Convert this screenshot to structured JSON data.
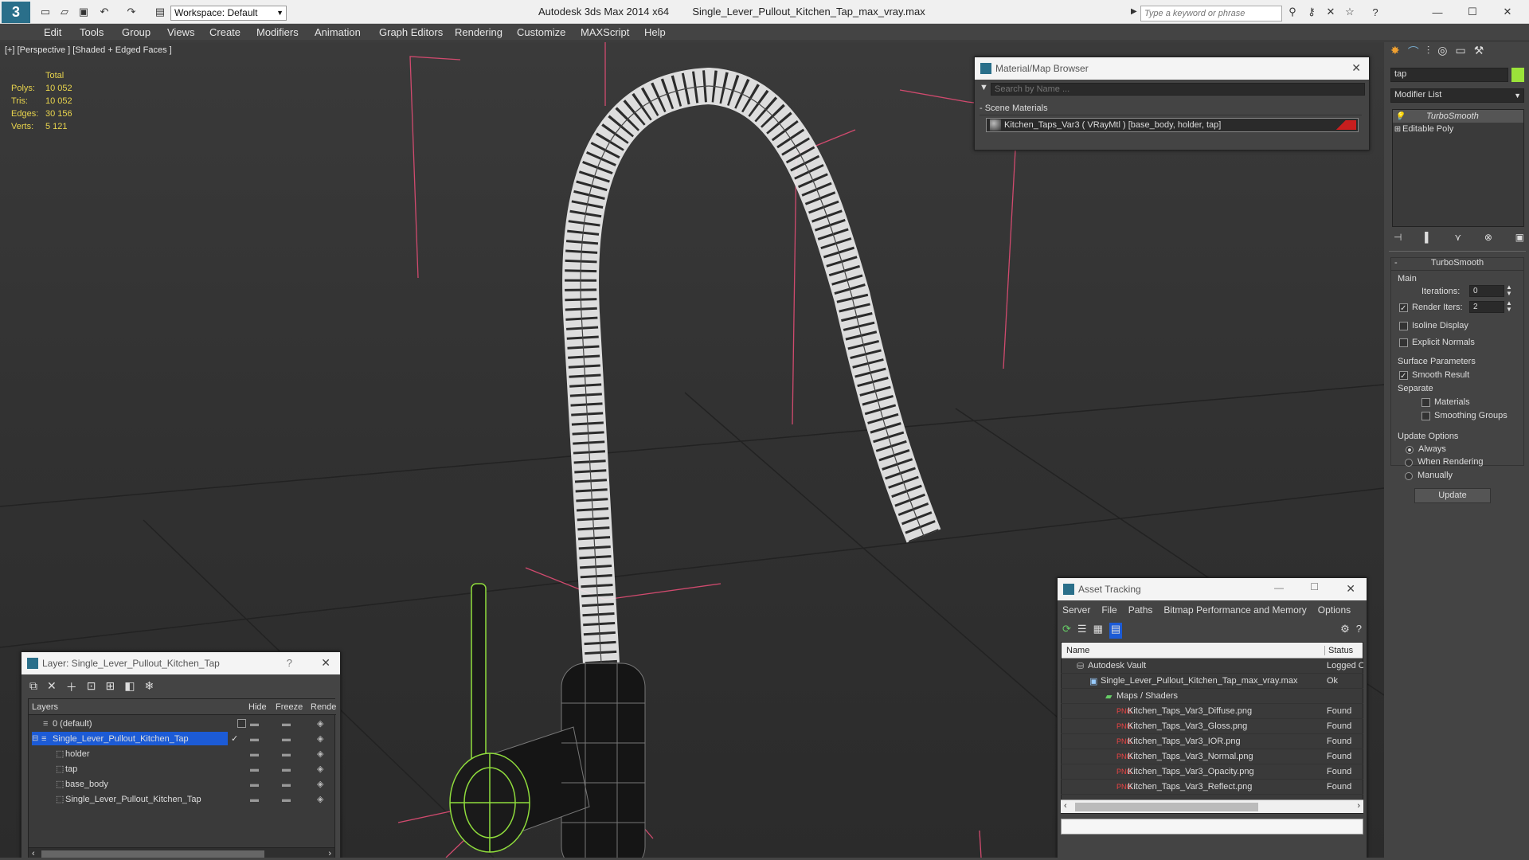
{
  "titlebar": {
    "app": "Autodesk 3ds Max  2014 x64",
    "file": "Single_Lever_Pullout_Kitchen_Tap_max_vray.max",
    "workspace": "Workspace: Default",
    "search_placeholder": "Type a keyword or phrase"
  },
  "menu": [
    "Edit",
    "Tools",
    "Group",
    "Views",
    "Create",
    "Modifiers",
    "Animation",
    "Graph Editors",
    "Rendering",
    "Customize",
    "MAXScript",
    "Help"
  ],
  "viewport": {
    "label": "[+] [Perspective ] [Shaded + Edged Faces ]",
    "stats_header": "Total",
    "stats": [
      {
        "label": "Polys:",
        "value": "10 052"
      },
      {
        "label": "Tris:",
        "value": "10 052"
      },
      {
        "label": "Edges:",
        "value": "30 156"
      },
      {
        "label": "Verts:",
        "value": "5 121"
      }
    ]
  },
  "material_browser": {
    "title": "Material/Map Browser",
    "search_placeholder": "Search by Name ...",
    "section": "- Scene Materials",
    "item": "Kitchen_Taps_Var3  ( VRayMtl ) [base_body, holder, tap]"
  },
  "layer_window": {
    "title": "Layer: Single_Lever_Pullout_Kitchen_Tap",
    "help": "?",
    "columns": [
      "Layers",
      "Hide",
      "Freeze",
      "Render"
    ],
    "rows": [
      {
        "name": "0 (default)",
        "indent": 0
      },
      {
        "name": "Single_Lever_Pullout_Kitchen_Tap",
        "indent": 0,
        "selected": true
      },
      {
        "name": "holder",
        "indent": 1
      },
      {
        "name": "tap",
        "indent": 1
      },
      {
        "name": "base_body",
        "indent": 1
      },
      {
        "name": "Single_Lever_Pullout_Kitchen_Tap",
        "indent": 1
      }
    ]
  },
  "asset_tracking": {
    "title": "Asset Tracking",
    "menu": [
      "Server",
      "File",
      "Paths",
      "Bitmap Performance and Memory",
      "Options"
    ],
    "columns": [
      "Name",
      "Status"
    ],
    "rows": [
      {
        "name": "Autodesk Vault",
        "status": "Logged O",
        "level": 1
      },
      {
        "name": "Single_Lever_Pullout_Kitchen_Tap_max_vray.max",
        "status": "Ok",
        "level": 2
      },
      {
        "name": "Maps / Shaders",
        "status": "",
        "level": 3
      },
      {
        "name": "Kitchen_Taps_Var3_Diffuse.png",
        "status": "Found",
        "level": 4
      },
      {
        "name": "Kitchen_Taps_Var3_Gloss.png",
        "status": "Found",
        "level": 4
      },
      {
        "name": "Kitchen_Taps_Var3_IOR.png",
        "status": "Found",
        "level": 4
      },
      {
        "name": "Kitchen_Taps_Var3_Normal.png",
        "status": "Found",
        "level": 4
      },
      {
        "name": "Kitchen_Taps_Var3_Opacity.png",
        "status": "Found",
        "level": 4
      },
      {
        "name": "Kitchen_Taps_Var3_Reflect.png",
        "status": "Found",
        "level": 4
      }
    ]
  },
  "command_panel": {
    "object_name": "tap",
    "modifier_list": "Modifier List",
    "stack": [
      "TurboSmooth",
      "Editable Poly"
    ],
    "rollout_title": "TurboSmooth",
    "main_label": "Main",
    "iterations_label": "Iterations:",
    "iterations_value": "0",
    "render_iters_label": "Render Iters:",
    "render_iters_value": "2",
    "isoline": "Isoline Display",
    "explicit_normals": "Explicit Normals",
    "surface_params": "Surface Parameters",
    "smooth_result": "Smooth Result",
    "separate": "Separate",
    "materials": "Materials",
    "smoothing_groups": "Smoothing Groups",
    "update_options": "Update Options",
    "always": "Always",
    "when_rendering": "When Rendering",
    "manually": "Manually",
    "update_button": "Update"
  },
  "colors": {
    "accent": "#3399ff",
    "selection": "#1c5bd6",
    "hud": "#e8d44d",
    "green": "#8fdc3c"
  }
}
